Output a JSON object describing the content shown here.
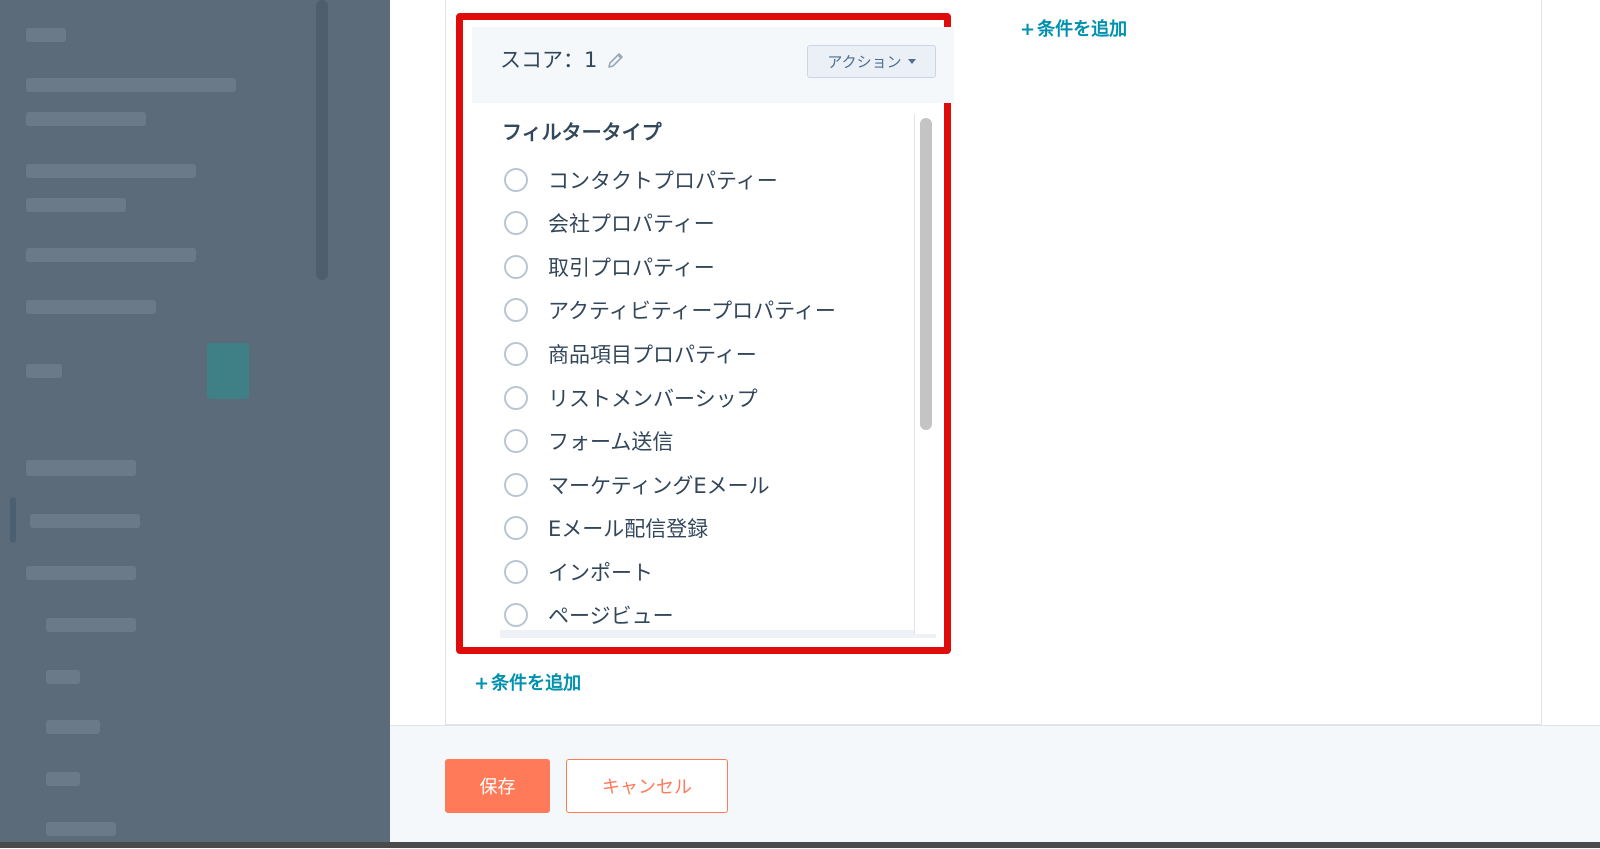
{
  "card": {
    "score_label": "スコア：1",
    "action_button": "アクション",
    "filter_type_title": "フィルタータイプ",
    "filter_options": [
      "コンタクトプロパティー",
      "会社プロパティー",
      "取引プロパティー",
      "アクティビティープロパティー",
      "商品項目プロパティー",
      "リストメンバーシップ",
      "フォーム送信",
      "マーケティングEメール",
      "Eメール配信登録",
      "インポート",
      "ページビュー"
    ]
  },
  "add_condition_label": "条件を追加",
  "add_condition_plus": "+",
  "footer": {
    "save_label": "保存",
    "cancel_label": "キャンセル"
  },
  "colors": {
    "accent_link": "#0091ae",
    "primary_button": "#ff7a59",
    "highlight_border": "#e00b0b"
  }
}
